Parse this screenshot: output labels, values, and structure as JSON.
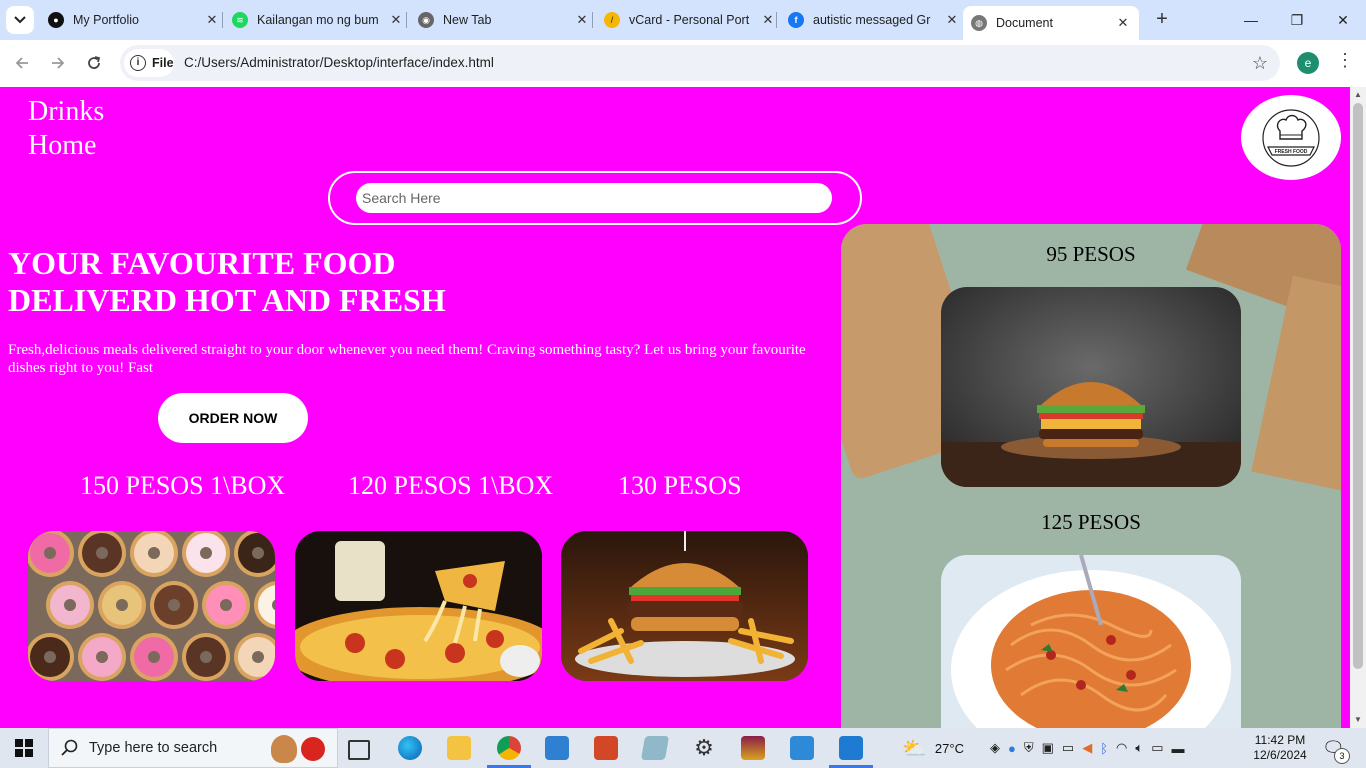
{
  "browser": {
    "tabs": [
      {
        "title": "My Portfolio",
        "icon": "github-icon"
      },
      {
        "title": "Kailangan mo ng bum",
        "icon": "spotify-icon"
      },
      {
        "title": "New Tab",
        "icon": "chrome-icon"
      },
      {
        "title": "vCard - Personal Port",
        "icon": "vcard-icon"
      },
      {
        "title": "autistic messaged Gr",
        "icon": "facebook-icon"
      },
      {
        "title": "Document",
        "icon": "globe-icon",
        "active": true
      }
    ],
    "site_chip": "File",
    "url": "C:/Users/Administrator/Desktop/interface/index.html",
    "profile_initial": "e"
  },
  "page": {
    "nav": [
      "Drinks",
      "Home"
    ],
    "logo_text": "FRESH FOOD",
    "search_placeholder": "Search Here",
    "hero_title_line1": "YOUR FAVOURITE FOOD",
    "hero_title_line2": "DELIVERD HOT AND FRESH",
    "hero_text": "Fresh,delicious meals delivered straight to your door whenever you need them! Craving something tasty? Let us bring your favourite dishes right to you! Fast",
    "order_button": "ORDER NOW",
    "products": [
      {
        "price": "150 PESOS 1\\BOX",
        "image": "donuts"
      },
      {
        "price": "120 PESOS 1\\BOX",
        "image": "pizza"
      },
      {
        "price": "130 PESOS",
        "image": "burger-and-fries"
      }
    ],
    "side_items": [
      {
        "price": "95 PESOS",
        "image": "burger"
      },
      {
        "price": "125 PESOS",
        "image": "spaghetti"
      }
    ],
    "colors": {
      "page_bg": "#ff00ff",
      "text": "#ffffff"
    }
  },
  "taskbar": {
    "search_placeholder": "Type here to search",
    "weather": "27°C",
    "time": "11:42 PM",
    "date": "12/6/2024",
    "notifications": "3"
  }
}
